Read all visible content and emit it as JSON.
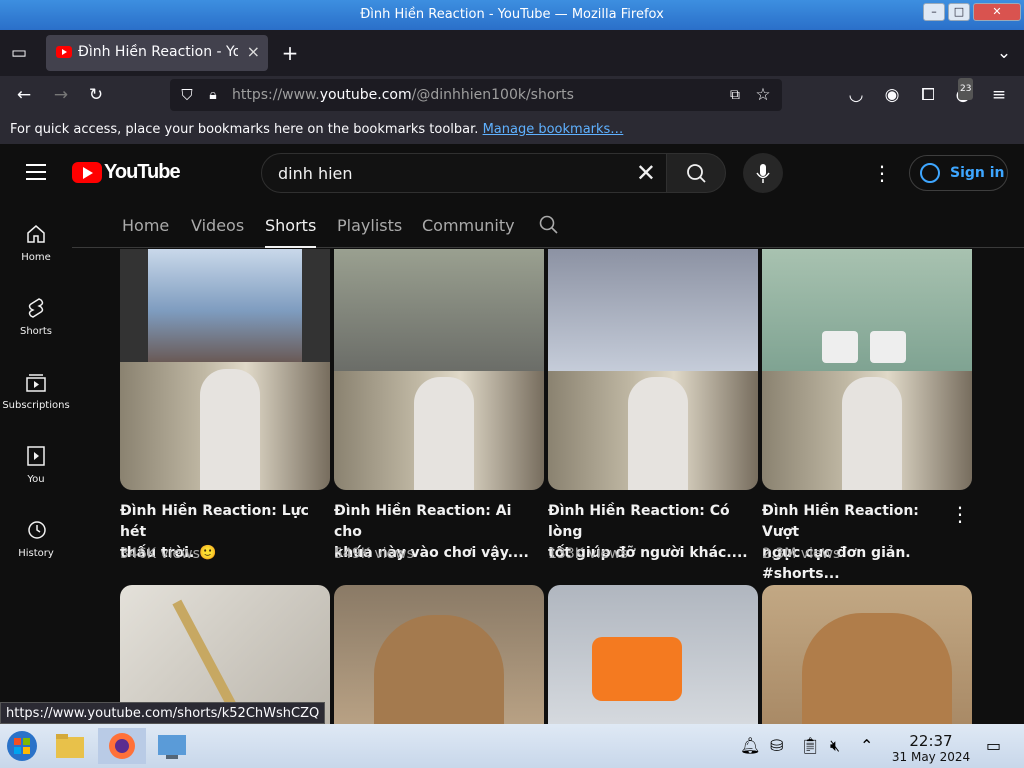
{
  "window": {
    "title": "Đình Hiền Reaction - YouTube — Mozilla Firefox"
  },
  "tab": {
    "label": "Đình Hiền Reaction - You",
    "close": "×",
    "new": "+"
  },
  "nav": {
    "url_prefix": "https://www.",
    "url_domain": "youtube.com",
    "url_path": "/@dinhhien100k/shorts",
    "badge": "23"
  },
  "bookmarks": {
    "text": "For quick access, place your bookmarks here on the bookmarks toolbar.",
    "link": "Manage bookmarks…"
  },
  "yt": {
    "logo": "YouTube",
    "query": "dinh hien",
    "signin": "Sign in"
  },
  "rail": [
    {
      "label": "Home",
      "icon": "home-icon"
    },
    {
      "label": "Shorts",
      "icon": "shorts-icon"
    },
    {
      "label": "Subscriptions",
      "icon": "subscriptions-icon"
    },
    {
      "label": "You",
      "icon": "you-icon"
    },
    {
      "label": "History",
      "icon": "history-icon"
    }
  ],
  "channel_tabs": [
    "Home",
    "Videos",
    "Shorts",
    "Playlists",
    "Community"
  ],
  "videos": [
    {
      "title1": "Đình Hiền Reaction: Lực hét",
      "title2": "thấu trời. 🙂",
      "views": "346K views"
    },
    {
      "title1": "Đình Hiền Reaction: Ai cho",
      "title2": "khứa này vào chơi vậy....",
      "views": "549K views"
    },
    {
      "title1": "Đình Hiền Reaction: Có lòng",
      "title2": "tốt giúp đỡ người khác....",
      "views": "133K views"
    },
    {
      "title1": "Đình Hiền Reaction: Vượt",
      "title2": "ngục cực đơn giản. #shorts...",
      "views": "2.3M views"
    }
  ],
  "status_url": "https://www.youtube.com/shorts/k52ChWshCZQ",
  "taskbar": {
    "time": "22:37",
    "date": "31 May 2024"
  }
}
